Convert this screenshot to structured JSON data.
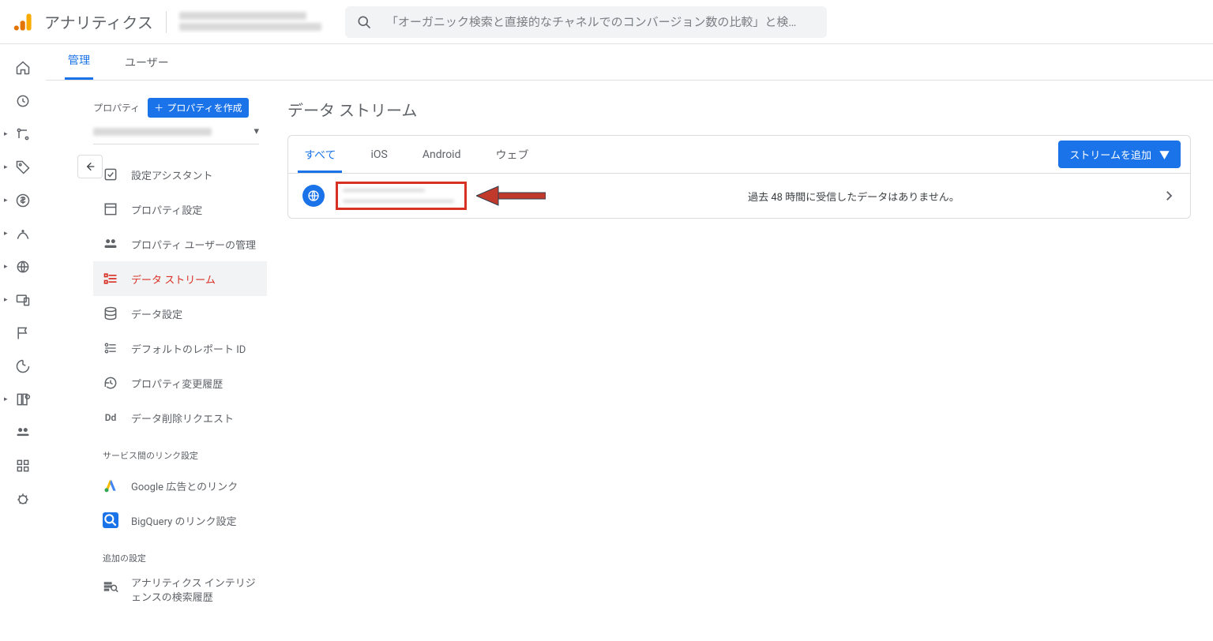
{
  "app_title": "アナリティクス",
  "search_placeholder": "「オーガニック検索と直接的なチャネルでのコンバージョン数の比較」と検…",
  "sub_tabs": {
    "admin": "管理",
    "user": "ユーザー"
  },
  "sidebar": {
    "property_label": "プロパティ",
    "create_property": "プロパティを作成",
    "items": {
      "setup_assistant": "設定アシスタント",
      "property_settings": "プロパティ設定",
      "property_users": "プロパティ ユーザーの管理",
      "data_streams": "データ ストリーム",
      "data_settings": "データ設定",
      "default_report_id": "デフォルトのレポート ID",
      "change_history": "プロパティ変更履歴",
      "delete_requests": "データ削除リクエスト"
    },
    "section_links": "サービス間のリンク設定",
    "google_ads": "Google 広告とのリンク",
    "bigquery": "BigQuery のリンク設定",
    "section_additional": "追加の設定",
    "intelligence": "アナリティクス インテリジェンスの検索履歴"
  },
  "page": {
    "title": "データ ストリーム",
    "tabs": {
      "all": "すべて",
      "ios": "iOS",
      "android": "Android",
      "web": "ウェブ"
    },
    "add_stream": "ストリームを追加",
    "row_status": "過去 48 時間に受信したデータはありません。"
  }
}
